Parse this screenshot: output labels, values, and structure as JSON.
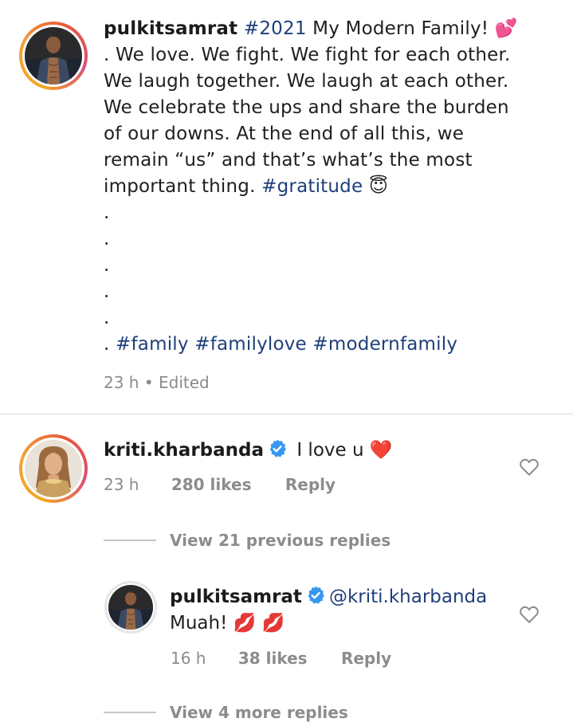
{
  "post": {
    "username": "pulkitsamrat",
    "caption_lines": [
      {
        "parts": [
          {
            "text": "#2021",
            "tag": true
          },
          {
            "text": " My Modern Family! 💕",
            "tag": false
          }
        ]
      },
      {
        "parts": [
          {
            "text": ". We love. We fight. We fight for each other.",
            "tag": false
          }
        ]
      },
      {
        "parts": [
          {
            "text": "We laugh together. We laugh at each other.",
            "tag": false
          }
        ]
      },
      {
        "parts": [
          {
            "text": "We celebrate the ups and share the burden",
            "tag": false
          }
        ]
      },
      {
        "parts": [
          {
            "text": "of our downs. At the end of all this, we",
            "tag": false
          }
        ]
      },
      {
        "parts": [
          {
            "text": "remain “us” and that’s what’s the most",
            "tag": false
          }
        ]
      },
      {
        "parts": [
          {
            "text": "important thing. ",
            "tag": false
          },
          {
            "text": "#gratitude",
            "tag": true
          },
          {
            "text": " 😇",
            "tag": false
          }
        ]
      }
    ],
    "dot_lines": [
      ".",
      ".",
      ".",
      ".",
      "."
    ],
    "final_line": {
      "prefix": ". ",
      "tags": [
        "#family",
        "#familylove",
        "#modernfamily"
      ]
    },
    "time": "23 h",
    "separator": "•",
    "edited": "Edited"
  },
  "comment": {
    "username": "kriti.kharbanda",
    "text": "I love u ❤️",
    "time": "23 h",
    "likes": "280 likes",
    "reply_label": "Reply",
    "view_previous": "View 21 previous replies"
  },
  "reply": {
    "username": "pulkitsamrat",
    "mention": "@kriti.kharbanda",
    "text": "Muah! 💋 💋",
    "time": "16 h",
    "likes": "38 likes",
    "reply_label": "Reply",
    "view_more": "View 4 more replies"
  },
  "colors": {
    "hashtag": "#1f3f7a",
    "verified": "#3897f0",
    "meta_gray": "#8c8c8c",
    "story_ring": "#f0a33a"
  },
  "icons": {
    "verified": "verified-badge-icon",
    "like": "heart-outline-icon"
  }
}
